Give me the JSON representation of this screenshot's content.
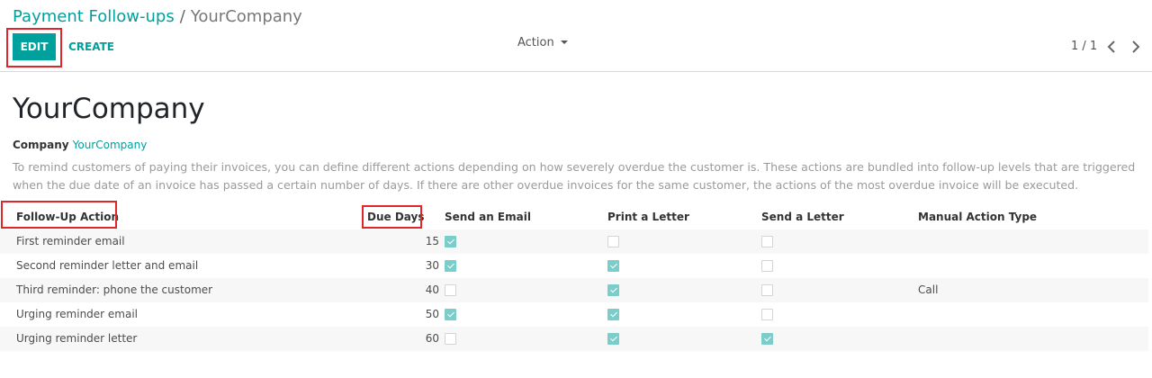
{
  "breadcrumb": {
    "parent": "Payment Follow-ups",
    "separator": "/",
    "current": "YourCompany"
  },
  "toolbar": {
    "edit_label": "EDIT",
    "create_label": "CREATE",
    "action_label": "Action"
  },
  "pager": {
    "value": "1 / 1"
  },
  "record": {
    "title": "YourCompany",
    "company_label": "Company",
    "company_value": "YourCompany",
    "help_text": "To remind customers of paying their invoices, you can define different actions depending on how severely overdue the customer is. These actions are bundled into follow-up levels that are triggered when the due date of an invoice has passed a certain number of days. If there are other overdue invoices for the same customer, the actions of the most overdue invoice will be executed."
  },
  "table": {
    "headers": {
      "action": "Follow-Up Action",
      "due_days": "Due Days",
      "send_email": "Send an Email",
      "print_letter": "Print a Letter",
      "send_letter": "Send a Letter",
      "manual_action_type": "Manual Action Type"
    },
    "rows": [
      {
        "action": "First reminder email",
        "due_days": "15",
        "send_email": true,
        "print_letter": false,
        "send_letter": false,
        "manual_action_type": ""
      },
      {
        "action": "Second reminder letter and email",
        "due_days": "30",
        "send_email": true,
        "print_letter": true,
        "send_letter": false,
        "manual_action_type": ""
      },
      {
        "action": "Third reminder: phone the customer",
        "due_days": "40",
        "send_email": false,
        "print_letter": true,
        "send_letter": false,
        "manual_action_type": "Call"
      },
      {
        "action": "Urging reminder email",
        "due_days": "50",
        "send_email": true,
        "print_letter": true,
        "send_letter": false,
        "manual_action_type": ""
      },
      {
        "action": "Urging reminder letter",
        "due_days": "60",
        "send_email": false,
        "print_letter": true,
        "send_letter": true,
        "manual_action_type": ""
      }
    ]
  },
  "colors": {
    "accent": "#00a09d",
    "checkbox_checked": "#7bcdc9",
    "highlight": "#e0252c"
  }
}
